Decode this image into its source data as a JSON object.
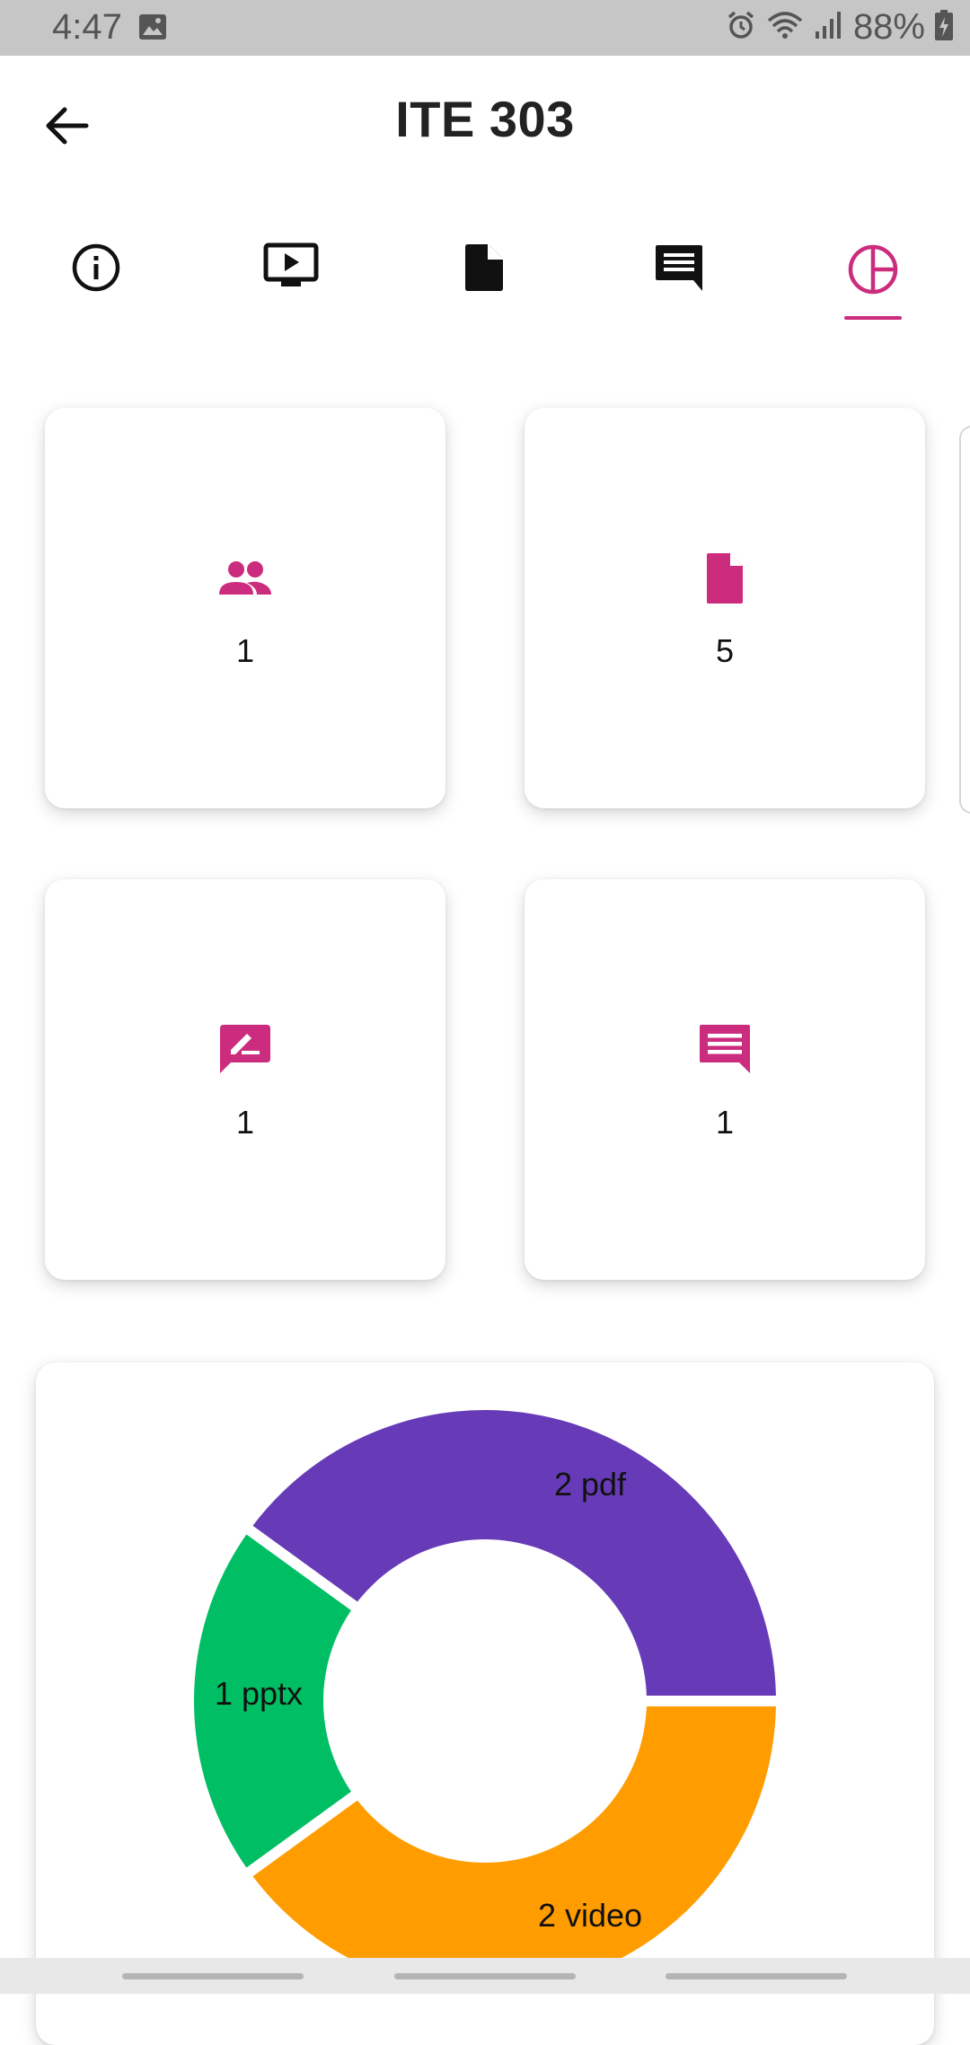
{
  "status_bar": {
    "time": "4:47",
    "battery": "88%"
  },
  "header": {
    "title": "ITE 303"
  },
  "tabs": [
    {
      "name": "info",
      "icon": "info-icon",
      "active": false
    },
    {
      "name": "video",
      "icon": "video-icon",
      "active": false
    },
    {
      "name": "file",
      "icon": "file-icon",
      "active": false
    },
    {
      "name": "chat",
      "icon": "chat-icon",
      "active": false
    },
    {
      "name": "stats",
      "icon": "pie-chart-icon",
      "active": true
    }
  ],
  "stats": [
    {
      "icon": "people-icon",
      "value": "1"
    },
    {
      "icon": "file-icon",
      "value": "5"
    },
    {
      "icon": "edit-comment-icon",
      "value": "1"
    },
    {
      "icon": "comment-icon",
      "value": "1"
    }
  ],
  "colors": {
    "accent": "#cc2c7e",
    "pdf": "#673ab7",
    "pptx": "#00be63",
    "video": "#ff9c00"
  },
  "chart_data": {
    "type": "pie",
    "categories": [
      "pdf",
      "pptx",
      "video"
    ],
    "values": [
      2,
      1,
      2
    ],
    "labels": [
      "2 pdf",
      "1 pptx",
      "2 video"
    ]
  }
}
